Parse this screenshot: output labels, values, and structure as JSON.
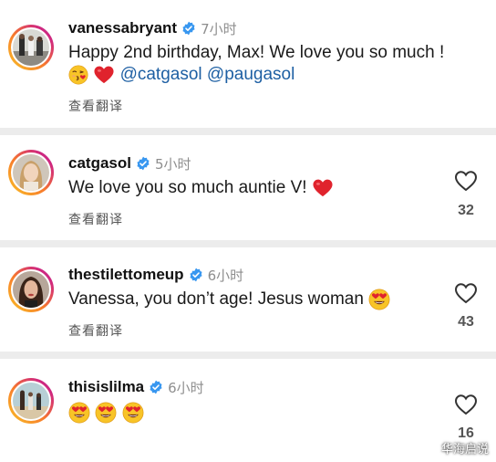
{
  "translate_label": "查看翻译",
  "comments": [
    {
      "username": "vanessabryant",
      "time": "7小时",
      "text": "Happy 2nd birthday, Max! We love you so much !",
      "mentions": [
        "@catgasol",
        "@paugasol"
      ],
      "emoji": [
        "kissing-heart-emoji",
        "red-heart-emoji"
      ],
      "likes": null
    },
    {
      "username": "catgasol",
      "time": "5小时",
      "text": "We love you so much auntie V!",
      "emoji": [
        "red-heart-emoji"
      ],
      "likes": "32"
    },
    {
      "username": "thestilettomeup",
      "time": "6小时",
      "text": "Vanessa, you don’t age! Jesus woman",
      "emoji": [
        "heart-eyes-emoji"
      ],
      "likes": "43"
    },
    {
      "username": "thisislilma",
      "time": "6小时",
      "text": "",
      "emoji": [
        "heart-eyes-emoji",
        "heart-eyes-emoji",
        "heart-eyes-emoji"
      ],
      "likes": "16"
    }
  ],
  "watermark": "华海启说",
  "colors": {
    "verified": "#3897f0",
    "mention": "#1d5fa3",
    "divider": "#ececec"
  }
}
